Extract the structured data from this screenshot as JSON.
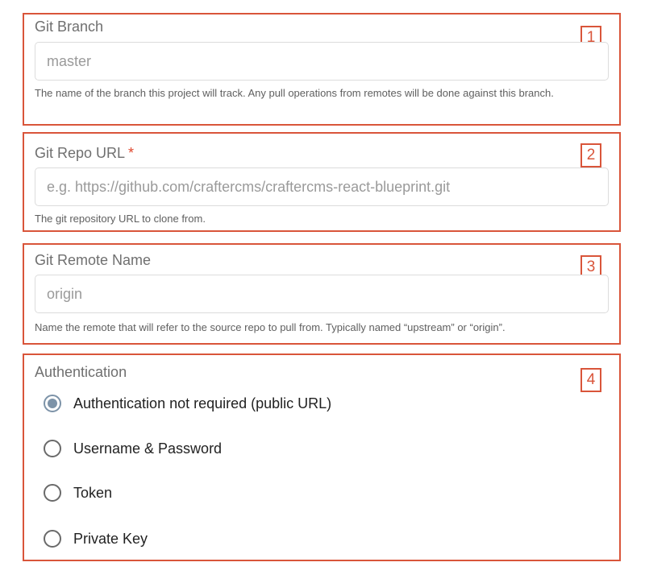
{
  "git_branch": {
    "label": "Git Branch",
    "placeholder": "master",
    "help": "The name of the branch this project will track. Any pull operations from remotes will be done against this branch.",
    "badge": "1"
  },
  "git_repo_url": {
    "label": "Git Repo URL",
    "required_marker": "*",
    "placeholder": "e.g. https://github.com/craftercms/craftercms-react-blueprint.git",
    "help": "The git repository URL to clone from.",
    "badge": "2"
  },
  "git_remote_name": {
    "label": "Git Remote Name",
    "placeholder": "origin",
    "help": "Name the remote that will refer to the source repo to pull from. Typically named “upstream” or “origin”.",
    "badge": "3"
  },
  "authentication": {
    "label": "Authentication",
    "badge": "4",
    "selected_index": 0,
    "options": [
      "Authentication not required (public URL)",
      "Username & Password",
      "Token",
      "Private Key"
    ]
  },
  "colors": {
    "annotation": "#d9553a",
    "required": "#e0472e",
    "radio_selected": "#7d93a8"
  }
}
